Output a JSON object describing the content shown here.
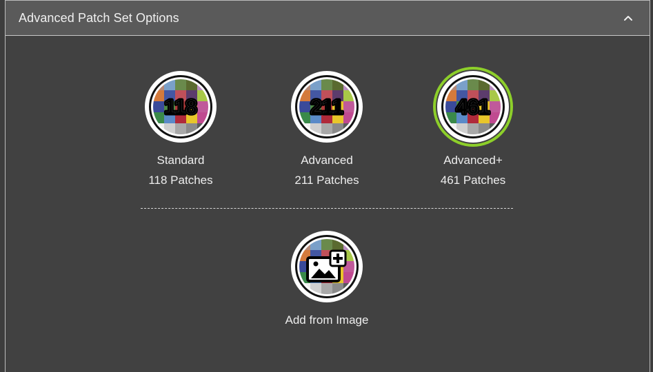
{
  "header": {
    "title": "Advanced Patch Set Options"
  },
  "options": [
    {
      "number": "118",
      "name": "Standard",
      "count": "118 Patches",
      "selected": false
    },
    {
      "number": "211",
      "name": "Advanced",
      "count": "211 Patches",
      "selected": false
    },
    {
      "number": "461",
      "name": "Advanced+",
      "count": "461 Patches",
      "selected": true
    }
  ],
  "add_option": {
    "label": "Add from Image",
    "icon": "add-image-icon"
  },
  "colors": {
    "selected_ring": "#8dcf2a",
    "panel_bg": "#414141",
    "header_bg": "#5a5a5a"
  }
}
